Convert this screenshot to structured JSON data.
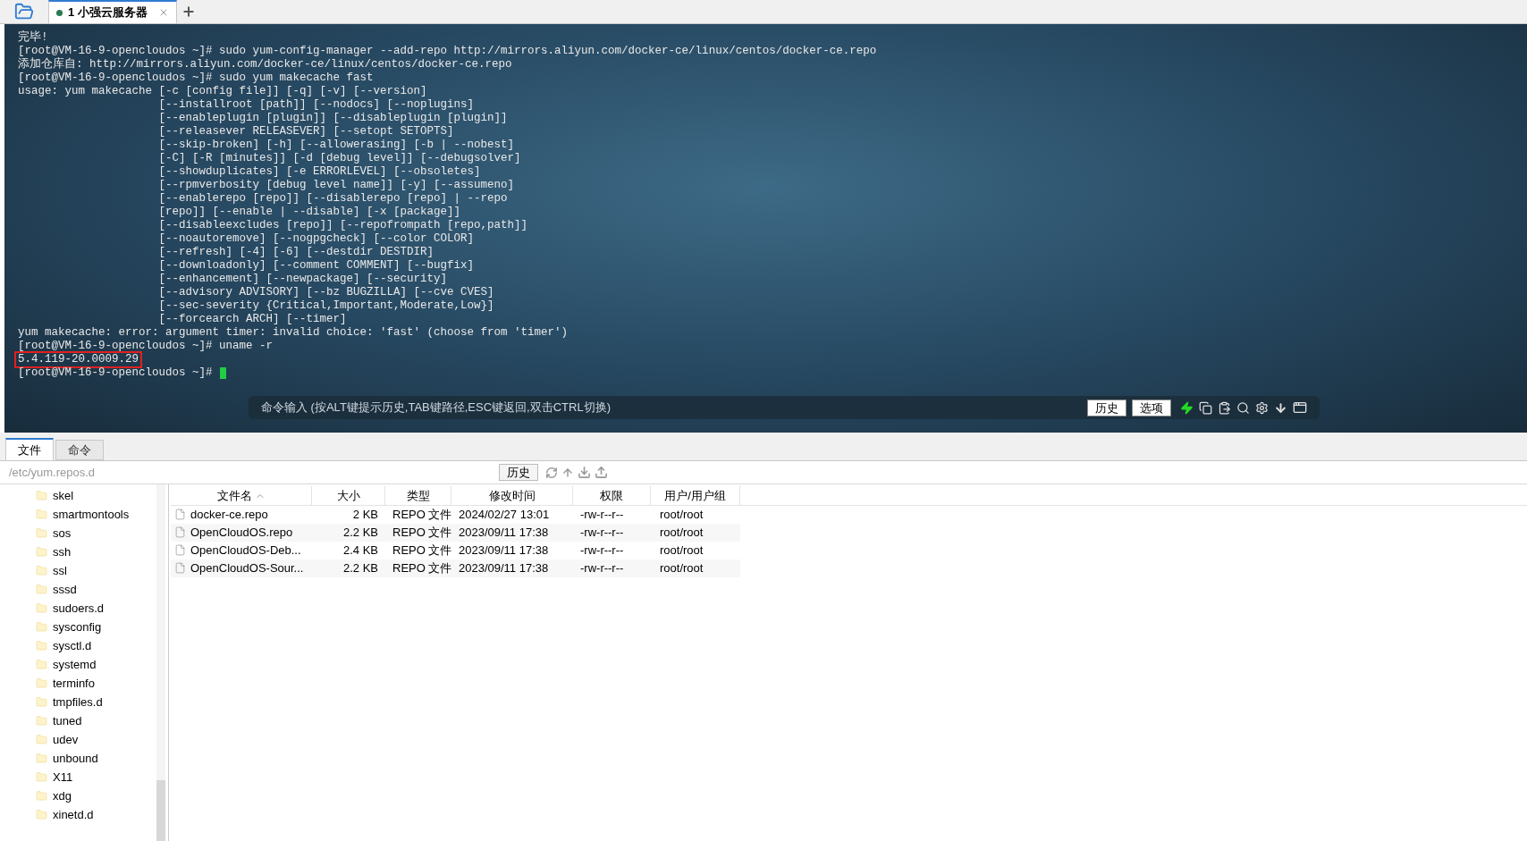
{
  "tabs": [
    {
      "label": "1 小强云服务器",
      "selected": true
    }
  ],
  "terminal": {
    "lines": [
      {
        "text": "完毕!",
        "highlighted": false
      },
      {
        "text": "[root@VM-16-9-opencloudos ~]# sudo yum-config-manager --add-repo http://mirrors.aliyun.com/docker-ce/linux/centos/docker-ce.repo",
        "highlighted": false
      },
      {
        "text": "添加仓库自: http://mirrors.aliyun.com/docker-ce/linux/centos/docker-ce.repo",
        "highlighted": false
      },
      {
        "text": "[root@VM-16-9-opencloudos ~]# sudo yum makecache fast",
        "highlighted": false
      },
      {
        "text": "usage: yum makecache [-c [config file]] [-q] [-v] [--version]",
        "highlighted": false
      },
      {
        "text": "                     [--installroot [path]] [--nodocs] [--noplugins]",
        "highlighted": false
      },
      {
        "text": "                     [--enableplugin [plugin]] [--disableplugin [plugin]]",
        "highlighted": false
      },
      {
        "text": "                     [--releasever RELEASEVER] [--setopt SETOPTS]",
        "highlighted": false
      },
      {
        "text": "                     [--skip-broken] [-h] [--allowerasing] [-b | --nobest]",
        "highlighted": false
      },
      {
        "text": "                     [-C] [-R [minutes]] [-d [debug level]] [--debugsolver]",
        "highlighted": false
      },
      {
        "text": "                     [--showduplicates] [-e ERRORLEVEL] [--obsoletes]",
        "highlighted": false
      },
      {
        "text": "                     [--rpmverbosity [debug level name]] [-y] [--assumeno]",
        "highlighted": false
      },
      {
        "text": "                     [--enablerepo [repo]] [--disablerepo [repo] | --repo",
        "highlighted": false
      },
      {
        "text": "                     [repo]] [--enable | --disable] [-x [package]]",
        "highlighted": false
      },
      {
        "text": "                     [--disableexcludes [repo]] [--repofrompath [repo,path]]",
        "highlighted": false
      },
      {
        "text": "                     [--noautoremove] [--nogpgcheck] [--color COLOR]",
        "highlighted": false
      },
      {
        "text": "                     [--refresh] [-4] [-6] [--destdir DESTDIR]",
        "highlighted": false
      },
      {
        "text": "                     [--downloadonly] [--comment COMMENT] [--bugfix]",
        "highlighted": false
      },
      {
        "text": "                     [--enhancement] [--newpackage] [--security]",
        "highlighted": false
      },
      {
        "text": "                     [--advisory ADVISORY] [--bz BUGZILLA] [--cve CVES]",
        "highlighted": false
      },
      {
        "text": "                     [--sec-severity {Critical,Important,Moderate,Low}]",
        "highlighted": false
      },
      {
        "text": "                     [--forcearch ARCH] [--timer]",
        "highlighted": false
      },
      {
        "text": "yum makecache: error: argument timer: invalid choice: 'fast' (choose from 'timer')",
        "highlighted": false
      },
      {
        "text": "[root@VM-16-9-opencloudos ~]# uname -r",
        "highlighted": false
      },
      {
        "text": "5.4.119-20.0009.29",
        "highlighted": true
      }
    ],
    "prompt": "[root@VM-16-9-opencloudos ~]#"
  },
  "command_bar": {
    "placeholder": "命令输入 (按ALT键提示历史,TAB键路径,ESC键返回,双击CTRL切换)",
    "buttons": [
      "历史",
      "选项"
    ]
  },
  "bottom_tabs": [
    {
      "label": "文件",
      "selected": true
    },
    {
      "label": "命令",
      "selected": false
    }
  ],
  "path_bar": {
    "path": "/etc/yum.repos.d",
    "button": "历史"
  },
  "tree": [
    "skel",
    "smartmontools",
    "sos",
    "ssh",
    "ssl",
    "sssd",
    "sudoers.d",
    "sysconfig",
    "sysctl.d",
    "systemd",
    "terminfo",
    "tmpfiles.d",
    "tuned",
    "udev",
    "unbound",
    "X11",
    "xdg",
    "xinetd.d"
  ],
  "file_table": {
    "columns": [
      {
        "label": "文件名",
        "sorted": true
      },
      {
        "label": "大小",
        "sorted": false
      },
      {
        "label": "类型",
        "sorted": false
      },
      {
        "label": "修改时间",
        "sorted": false
      },
      {
        "label": "权限",
        "sorted": false
      },
      {
        "label": "用户/用户组",
        "sorted": false
      }
    ],
    "rows": [
      [
        "docker-ce.repo",
        "2 KB",
        "REPO 文件",
        "2024/02/27 13:01",
        "-rw-r--r--",
        "root/root"
      ],
      [
        "OpenCloudOS.repo",
        "2.2 KB",
        "REPO 文件",
        "2023/09/11 17:38",
        "-rw-r--r--",
        "root/root"
      ],
      [
        "OpenCloudOS-Deb...",
        "2.4 KB",
        "REPO 文件",
        "2023/09/11 17:38",
        "-rw-r--r--",
        "root/root"
      ],
      [
        "OpenCloudOS-Sour...",
        "2.2 KB",
        "REPO 文件",
        "2023/09/11 17:38",
        "-rw-r--r--",
        "root/root"
      ]
    ]
  }
}
